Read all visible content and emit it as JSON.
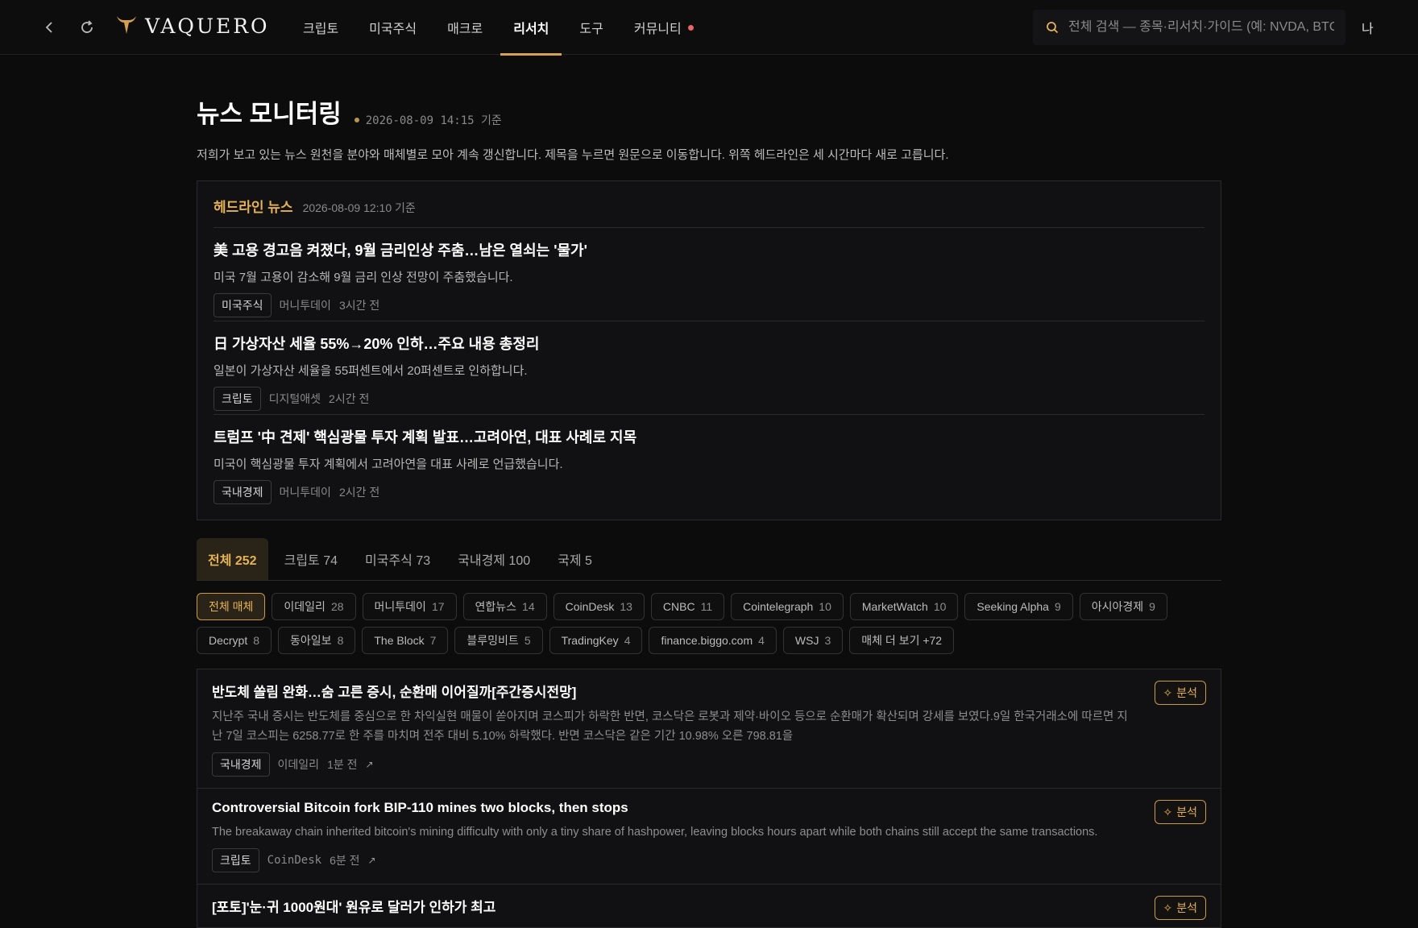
{
  "nav": {
    "brand": "VAQUERO",
    "items": [
      {
        "label": "크립토"
      },
      {
        "label": "미국주식"
      },
      {
        "label": "매크로"
      },
      {
        "label": "리서치"
      },
      {
        "label": "도구"
      },
      {
        "label": "커뮤니티"
      }
    ],
    "active_index": 3,
    "search_placeholder": "전체 검색 — 종목·리서치·가이드 (예: NVDA, BTC)",
    "user_label": "나"
  },
  "page": {
    "title": "뉴스 모니터링",
    "updated": "2026-08-09 14:15 기준",
    "description": "저희가 보고 있는 뉴스 원천을 분야와 매체별로 모아 계속 갱신합니다. 제목을 누르면 원문으로 이동합니다. 위쪽 헤드라인은 세 시간마다 새로 고릅니다."
  },
  "headlines": {
    "title": "헤드라인 뉴스",
    "time": "2026-08-09 12:10 기준",
    "items": [
      {
        "title": "美 고용 경고음 켜졌다, 9월 금리인상 주춤…남은 열쇠는 '물가'",
        "summary": "미국 7월 고용이 감소해 9월 금리 인상 전망이 주춤했습니다.",
        "tag": "미국주식",
        "source": "머니투데이",
        "age": "3시간 전"
      },
      {
        "title": "日 가상자산 세율 55%→20% 인하…주요 내용 총정리",
        "summary": "일본이 가상자산 세율을 55퍼센트에서 20퍼센트로 인하합니다.",
        "tag": "크립토",
        "source": "디지털애셋",
        "age": "2시간 전"
      },
      {
        "title": "트럼프 '中 견제' 핵심광물 투자 계획 발표…고려아연, 대표 사례로 지목",
        "summary": "미국이 핵심광물 투자 계획에서 고려아연을 대표 사례로 언급했습니다.",
        "tag": "국내경제",
        "source": "머니투데이",
        "age": "2시간 전"
      }
    ]
  },
  "tabs": [
    {
      "label": "전체 252"
    },
    {
      "label": "크립토 74"
    },
    {
      "label": "미국주식 73"
    },
    {
      "label": "국내경제 100"
    },
    {
      "label": "국제 5"
    }
  ],
  "chips": [
    {
      "label": "전체 매체",
      "count": ""
    },
    {
      "label": "이데일리",
      "count": "28"
    },
    {
      "label": "머니투데이",
      "count": "17"
    },
    {
      "label": "연합뉴스",
      "count": "14"
    },
    {
      "label": "CoinDesk",
      "count": "13"
    },
    {
      "label": "CNBC",
      "count": "11"
    },
    {
      "label": "Cointelegraph",
      "count": "10"
    },
    {
      "label": "MarketWatch",
      "count": "10"
    },
    {
      "label": "Seeking Alpha",
      "count": "9"
    },
    {
      "label": "아시아경제",
      "count": "9"
    },
    {
      "label": "Decrypt",
      "count": "8"
    },
    {
      "label": "동아일보",
      "count": "8"
    },
    {
      "label": "The Block",
      "count": "7"
    },
    {
      "label": "블루밍비트",
      "count": "5"
    },
    {
      "label": "TradingKey",
      "count": "4"
    },
    {
      "label": "finance.biggo.com",
      "count": "4"
    },
    {
      "label": "WSJ",
      "count": "3"
    },
    {
      "label": "매체 더 보기 +72",
      "count": ""
    }
  ],
  "feed": {
    "analyze_label": "분석",
    "items": [
      {
        "title": "반도체 쏠림 완화…숨 고른 증시, 순환매 이어질까[주간증시전망]",
        "summary": "지난주 국내 증시는 반도체를 중심으로 한 차익실현 매물이 쏟아지며 코스피가 하락한 반면, 코스닥은 로봇과 제약·바이오 등으로 순환매가 확산되며 강세를 보였다.9일 한국거래소에 따르면 지난 7일 코스피는 6258.77로 한 주를 마치며 전주 대비 5.10% 하락했다. 반면 코스닥은 같은 기간 10.98% 오른 798.81을",
        "tag": "국내경제",
        "source": "이데일리",
        "age": "1분 전"
      },
      {
        "title": "Controversial Bitcoin fork BIP-110 mines two blocks, then stops",
        "summary": "The breakaway chain inherited bitcoin's mining difficulty with only a tiny share of hashpower, leaving blocks hours apart while both chains still accept the same transactions.",
        "tag": "크립토",
        "source": "CoinDesk",
        "age": "6분 전"
      },
      {
        "title": "[포토]'눈·귀 1000원대' 원유로 달러가 인하가 최고",
        "summary": "",
        "tag": "",
        "source": "",
        "age": ""
      }
    ]
  },
  "colors": {
    "accent": "#e5b257",
    "notify": "#e56767",
    "bg": "#0c0c0d"
  }
}
